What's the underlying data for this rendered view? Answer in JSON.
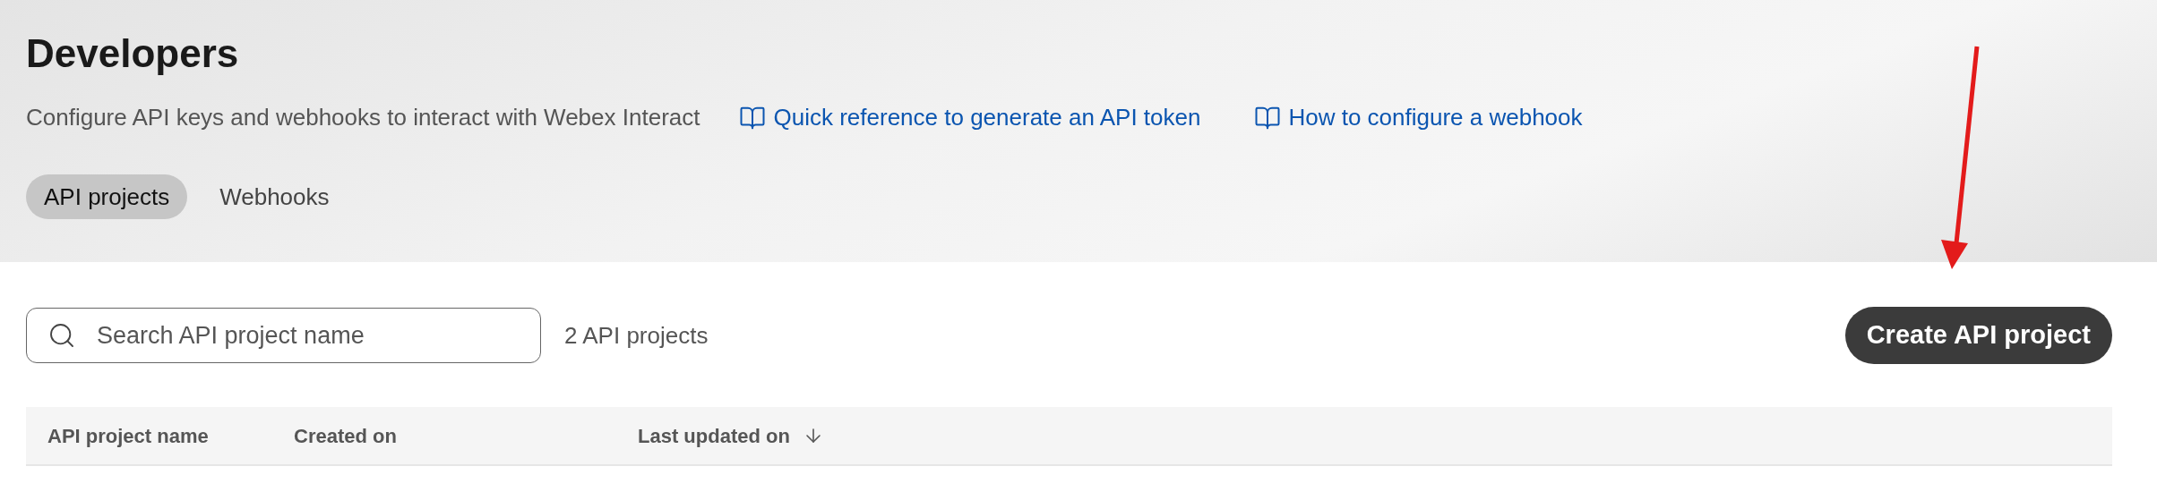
{
  "page": {
    "title": "Developers",
    "subtitle": "Configure API keys and webhooks to interact with Webex Interact"
  },
  "links": [
    {
      "label": "Quick reference to generate an API token"
    },
    {
      "label": "How to configure a webhook"
    }
  ],
  "tabs": [
    {
      "label": "API projects",
      "selected": true
    },
    {
      "label": "Webhooks",
      "selected": false
    }
  ],
  "search": {
    "placeholder": "Search API project name"
  },
  "count": "2 API projects",
  "create_button": "Create API project",
  "table": {
    "columns": [
      {
        "label": "API project name",
        "sorted": false
      },
      {
        "label": "Created on",
        "sorted": false
      },
      {
        "label": "Last updated on",
        "sorted": true
      }
    ]
  }
}
